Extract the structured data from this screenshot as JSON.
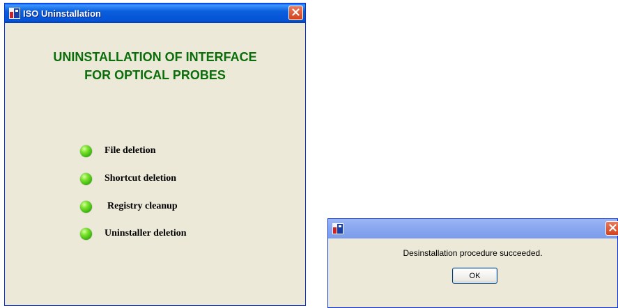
{
  "main_window": {
    "title": "ISO Uninstallation",
    "heading_line1": "UNINSTALLATION OF INTERFACE",
    "heading_line2": "FOR OPTICAL PROBES",
    "steps": [
      {
        "label": "File deletion",
        "status": "done"
      },
      {
        "label": "Shortcut deletion",
        "status": "done"
      },
      {
        "label": "Registry cleanup",
        "status": "done"
      },
      {
        "label": "Uninstaller deletion",
        "status": "done"
      }
    ],
    "icons": {
      "app": "app-icon",
      "close": "close-icon",
      "status": "status-led-icon"
    }
  },
  "message_dialog": {
    "title": "",
    "message": "Desinstallation procedure succeeded.",
    "ok_label": "OK"
  },
  "colors": {
    "heading": "#0a6e0a",
    "window_bg": "#ece9d8",
    "titlebar": "#0553d6",
    "led": "#3fb412"
  }
}
